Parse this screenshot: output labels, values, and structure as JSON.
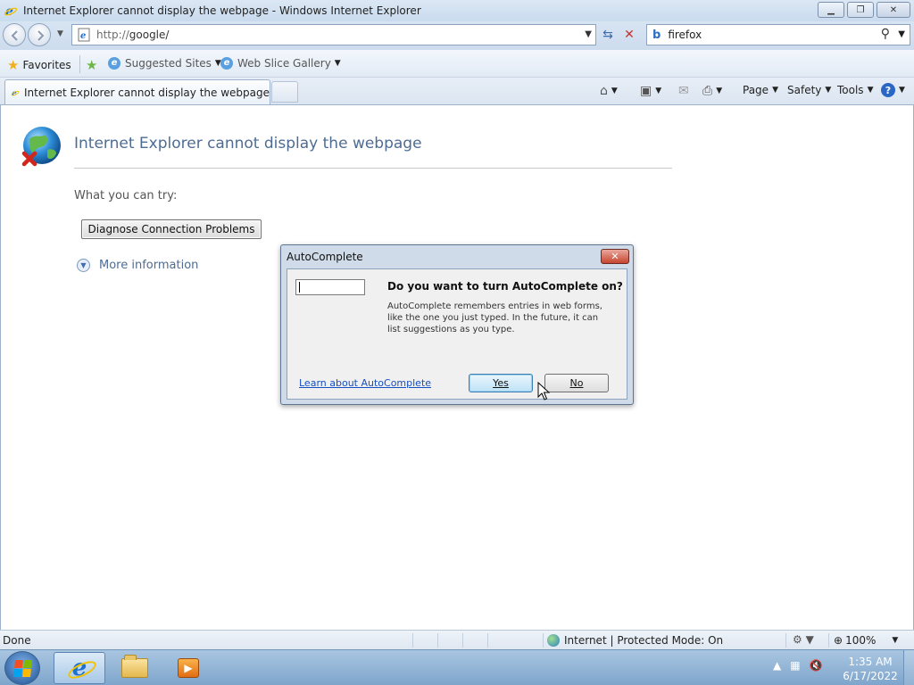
{
  "window": {
    "title": "Internet Explorer cannot display the webpage - Windows Internet Explorer",
    "minimize_icon": "minimize-icon",
    "restore_icon": "restore-icon",
    "close_icon": "close-icon"
  },
  "address_bar": {
    "prefix": "http://",
    "host": "google/",
    "refresh_icon": "refresh-icon",
    "stop_icon": "stop-icon"
  },
  "search": {
    "provider_icon": "bing-icon",
    "value": "firefox"
  },
  "favorites_bar": {
    "favorites_label": "Favorites",
    "suggested_sites_label": "Suggested Sites",
    "web_slice_gallery_label": "Web Slice Gallery"
  },
  "tabs": {
    "active_label": "Internet Explorer cannot display the webpage"
  },
  "command_bar": {
    "page_label": "Page",
    "safety_label": "Safety",
    "tools_label": "Tools"
  },
  "content": {
    "error_title": "Internet Explorer cannot display the webpage",
    "what_try": "What you can try:",
    "diagnose_label": "Diagnose Connection Problems",
    "more_info_label": "More information"
  },
  "dialog": {
    "title": "AutoComplete",
    "question": "Do you want to turn AutoComplete on?",
    "description": "AutoComplete remembers entries in web forms, like the one you just typed. In the future, it can list suggestions as you type.",
    "learn_link": "Learn about AutoComplete",
    "yes_label": "Yes",
    "no_label": "No",
    "input_value": ""
  },
  "status_bar": {
    "status_text": "Done",
    "zone_text": "Internet | Protected Mode: On",
    "zoom_text": "100%"
  },
  "taskbar": {
    "clock_time": "1:35 AM",
    "clock_date": "6/17/2022"
  },
  "colors": {
    "link": "#1650c0",
    "error_title": "#4e6c93",
    "close_red": "#c7452f"
  }
}
